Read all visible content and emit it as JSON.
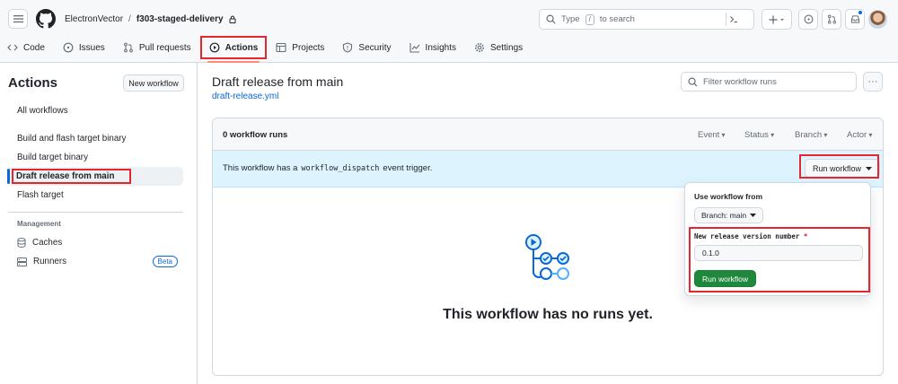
{
  "header": {
    "owner": "ElectronVector",
    "repo": "f303-staged-delivery",
    "search_placeholder_before": "Type",
    "search_key": "/",
    "search_placeholder_after": "to search"
  },
  "tabs": [
    {
      "label": "Code",
      "icon": "code-icon"
    },
    {
      "label": "Issues",
      "icon": "issue-icon"
    },
    {
      "label": "Pull requests",
      "icon": "pull-request-icon"
    },
    {
      "label": "Actions",
      "icon": "play-icon"
    },
    {
      "label": "Projects",
      "icon": "table-icon"
    },
    {
      "label": "Security",
      "icon": "shield-icon"
    },
    {
      "label": "Insights",
      "icon": "graph-icon"
    },
    {
      "label": "Settings",
      "icon": "gear-icon"
    }
  ],
  "sidebar": {
    "title": "Actions",
    "new_workflow": "New workflow",
    "all_workflows": "All workflows",
    "workflows": [
      "Build and flash target binary",
      "Build target binary",
      "Draft release from main",
      "Flash target"
    ],
    "management_heading": "Management",
    "caches": "Caches",
    "runners": "Runners",
    "beta": "Beta"
  },
  "main": {
    "title": "Draft release from main",
    "file": "draft-release.yml",
    "filter_placeholder": "Filter workflow runs",
    "runs_count": "0 workflow runs",
    "filters": [
      "Event",
      "Status",
      "Branch",
      "Actor"
    ],
    "banner_prefix": "This workflow has a",
    "banner_code": "workflow_dispatch",
    "banner_suffix": "event trigger.",
    "run_workflow": "Run workflow",
    "empty_title": "This workflow has no runs yet."
  },
  "popover": {
    "title": "Use workflow from",
    "branch": "Branch: main",
    "field_label": "New release version number",
    "required_mark": "*",
    "field_value": "0.1.0",
    "submit": "Run workflow"
  },
  "colors": {
    "accent": "#0969da",
    "highlight": "#e5262e",
    "success": "#1f883d",
    "banner": "#ddf4ff"
  }
}
